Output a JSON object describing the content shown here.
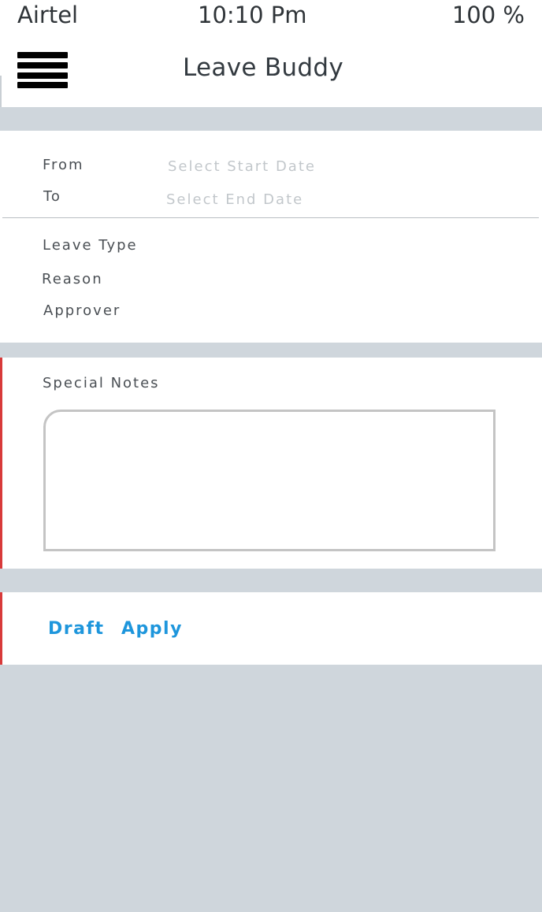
{
  "status_bar": {
    "carrier": "Airtel",
    "time": "10:10 Pm",
    "battery": "100 %"
  },
  "header": {
    "menu_icon": "hamburger-menu-icon",
    "title": "Leave Buddy"
  },
  "form": {
    "from_label": "From",
    "from_placeholder": "Select Start Date",
    "to_label": "To",
    "to_placeholder": "Select End Date",
    "leave_type_label": "Leave Type",
    "reason_label": "Reason",
    "approver_label": "Approver",
    "special_notes_label": "Special Notes",
    "special_notes_value": ""
  },
  "actions": {
    "draft_label": "Draft",
    "apply_label": "Apply"
  },
  "colors": {
    "background": "#cfd6dc",
    "accent": "#1e96dc",
    "edge_marker": "#d83a3a"
  }
}
